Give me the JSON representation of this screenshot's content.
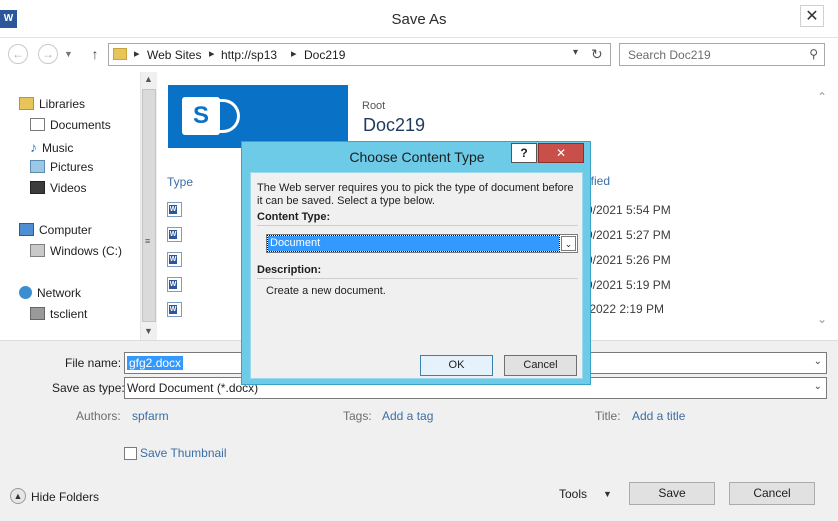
{
  "window": {
    "title": "Save As",
    "app_icon_label": "W",
    "close_glyph": "✕"
  },
  "nav": {
    "back_glyph": "←",
    "forward_glyph": "→",
    "up_glyph": "↑",
    "breadcrumbs": [
      "Web Sites",
      "http://sp13",
      "Doc219"
    ],
    "search_placeholder": "Search Doc219"
  },
  "sidebar": {
    "groups": [
      {
        "label": "Libraries",
        "icon": "libraries-icon",
        "children": [
          {
            "label": "Documents",
            "icon": "documents-icon"
          },
          {
            "label": "Music",
            "icon": "music-icon"
          },
          {
            "label": "Pictures",
            "icon": "pictures-icon"
          },
          {
            "label": "Videos",
            "icon": "videos-icon"
          }
        ]
      },
      {
        "label": "Computer",
        "icon": "computer-icon",
        "children": [
          {
            "label": "Windows (C:)",
            "icon": "drive-icon"
          }
        ]
      },
      {
        "label": "Network",
        "icon": "network-icon",
        "children": [
          {
            "label": "tsclient",
            "icon": "tsclient-icon"
          }
        ]
      }
    ]
  },
  "main": {
    "site_logo_letter": "S",
    "root_label": "Root",
    "library_title": "Doc219",
    "columns": {
      "type": "Type",
      "modified": "ified"
    },
    "file_dates": [
      "9/2021 5:54 PM",
      "9/2021 5:27 PM",
      "9/2021 5:26 PM",
      "9/2021 5:19 PM",
      "/2022 2:19 PM"
    ]
  },
  "form": {
    "file_name_label": "File name:",
    "file_name_value": "gfg2.docx",
    "save_type_label": "Save as type:",
    "save_type_value": "Word Document (*.docx)",
    "authors_label": "Authors:",
    "authors_value": "spfarm",
    "tags_label": "Tags:",
    "tags_value": "Add a tag",
    "title_label": "Title:",
    "title_value": "Add a title",
    "thumbnail_label": "Save Thumbnail",
    "hide_folders_label": "Hide Folders",
    "tools_label": "Tools",
    "save_label": "Save",
    "cancel_label": "Cancel"
  },
  "dialog": {
    "title": "Choose Content Type",
    "help_glyph": "?",
    "close_glyph": "✕",
    "message": "The Web server requires you to pick the type of document before it can be saved. Select a type below.",
    "content_type_label": "Content Type:",
    "content_type_value": "Document",
    "description_label": "Description:",
    "description_value": "Create a new document.",
    "ok_label": "OK",
    "cancel_label": "Cancel"
  }
}
